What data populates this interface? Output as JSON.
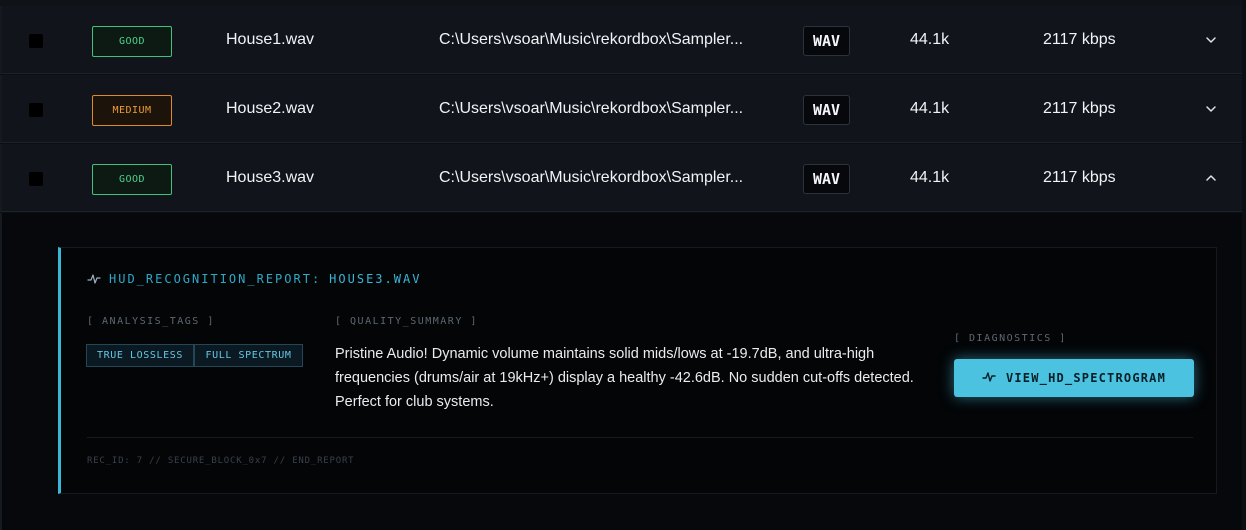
{
  "rows": [
    {
      "quality": "GOOD",
      "filename": "House1.wav",
      "path": "C:\\Users\\vsoar\\Music\\rekordbox\\Sampler...",
      "format": "WAV",
      "sample_rate": "44.1k",
      "bitrate": "2117 kbps",
      "expanded": false
    },
    {
      "quality": "MEDIUM",
      "filename": "House2.wav",
      "path": "C:\\Users\\vsoar\\Music\\rekordbox\\Sampler...",
      "format": "WAV",
      "sample_rate": "44.1k",
      "bitrate": "2117 kbps",
      "expanded": false
    },
    {
      "quality": "GOOD",
      "filename": "House3.wav",
      "path": "C:\\Users\\vsoar\\Music\\rekordbox\\Sampler...",
      "format": "WAV",
      "sample_rate": "44.1k",
      "bitrate": "2117 kbps",
      "expanded": true
    }
  ],
  "report": {
    "title_prefix": "HUD_RECOGNITION_REPORT:",
    "title_file": "HOUSE3.WAV",
    "tags_label": "[ ANALYSIS_TAGS ]",
    "tags": [
      "TRUE LOSSLESS",
      "FULL SPECTRUM"
    ],
    "summary_label": "[ QUALITY_SUMMARY ]",
    "summary": "Pristine Audio! Dynamic volume maintains solid mids/lows at -19.7dB, and ultra-high frequencies (drums/air at 19kHz+) display a healthy -42.6dB. No sudden cut-offs detected. Perfect for club systems.",
    "diagnostics_label": "[ DIAGNOSTICS ]",
    "spectrogram_button": "VIEW_HD_SPECTROGRAM",
    "footer": "REC_ID: 7 // SECURE_BLOCK_0x7 // END_REPORT"
  },
  "colors": {
    "good": "#3fc37a",
    "medium": "#e08a28",
    "accent": "#3ab6d6"
  },
  "icons": {
    "expand": "chevron-down-icon",
    "collapse": "chevron-up-icon",
    "report": "pulse-icon"
  }
}
